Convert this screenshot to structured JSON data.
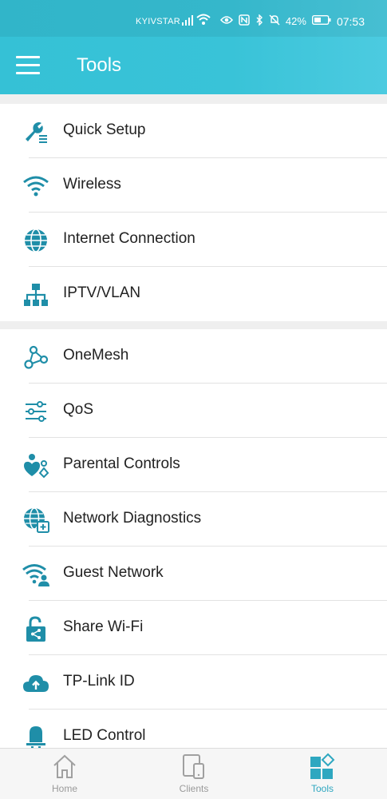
{
  "status_bar": {
    "carrier": "KYIVSTAR",
    "battery": "42%",
    "time": "07:53"
  },
  "app_bar": {
    "title": "Tools"
  },
  "groups": [
    {
      "items": [
        {
          "label": "Quick Setup",
          "icon": "wrench-icon"
        },
        {
          "label": "Wireless",
          "icon": "wifi-icon"
        },
        {
          "label": "Internet Connection",
          "icon": "globe-icon"
        },
        {
          "label": "IPTV/VLAN",
          "icon": "network-tree-icon"
        }
      ]
    },
    {
      "items": [
        {
          "label": "OneMesh",
          "icon": "mesh-nodes-icon"
        },
        {
          "label": "QoS",
          "icon": "sliders-icon"
        },
        {
          "label": "Parental Controls",
          "icon": "parental-icon"
        },
        {
          "label": "Network Diagnostics",
          "icon": "globe-diagnostics-icon"
        },
        {
          "label": "Guest Network",
          "icon": "guest-wifi-icon"
        },
        {
          "label": "Share Wi-Fi",
          "icon": "unlock-share-icon"
        },
        {
          "label": "TP-Link ID",
          "icon": "cloud-upload-icon"
        },
        {
          "label": "LED Control",
          "icon": "led-icon"
        }
      ]
    }
  ],
  "bottom_nav": [
    {
      "label": "Home",
      "icon": "home-icon",
      "active": false
    },
    {
      "label": "Clients",
      "icon": "devices-icon",
      "active": false
    },
    {
      "label": "Tools",
      "icon": "tools-grid-icon",
      "active": true
    }
  ],
  "colors": {
    "accent": "#2a9fb8",
    "header": "#39c3d8",
    "icon": "#1f8ea8"
  }
}
